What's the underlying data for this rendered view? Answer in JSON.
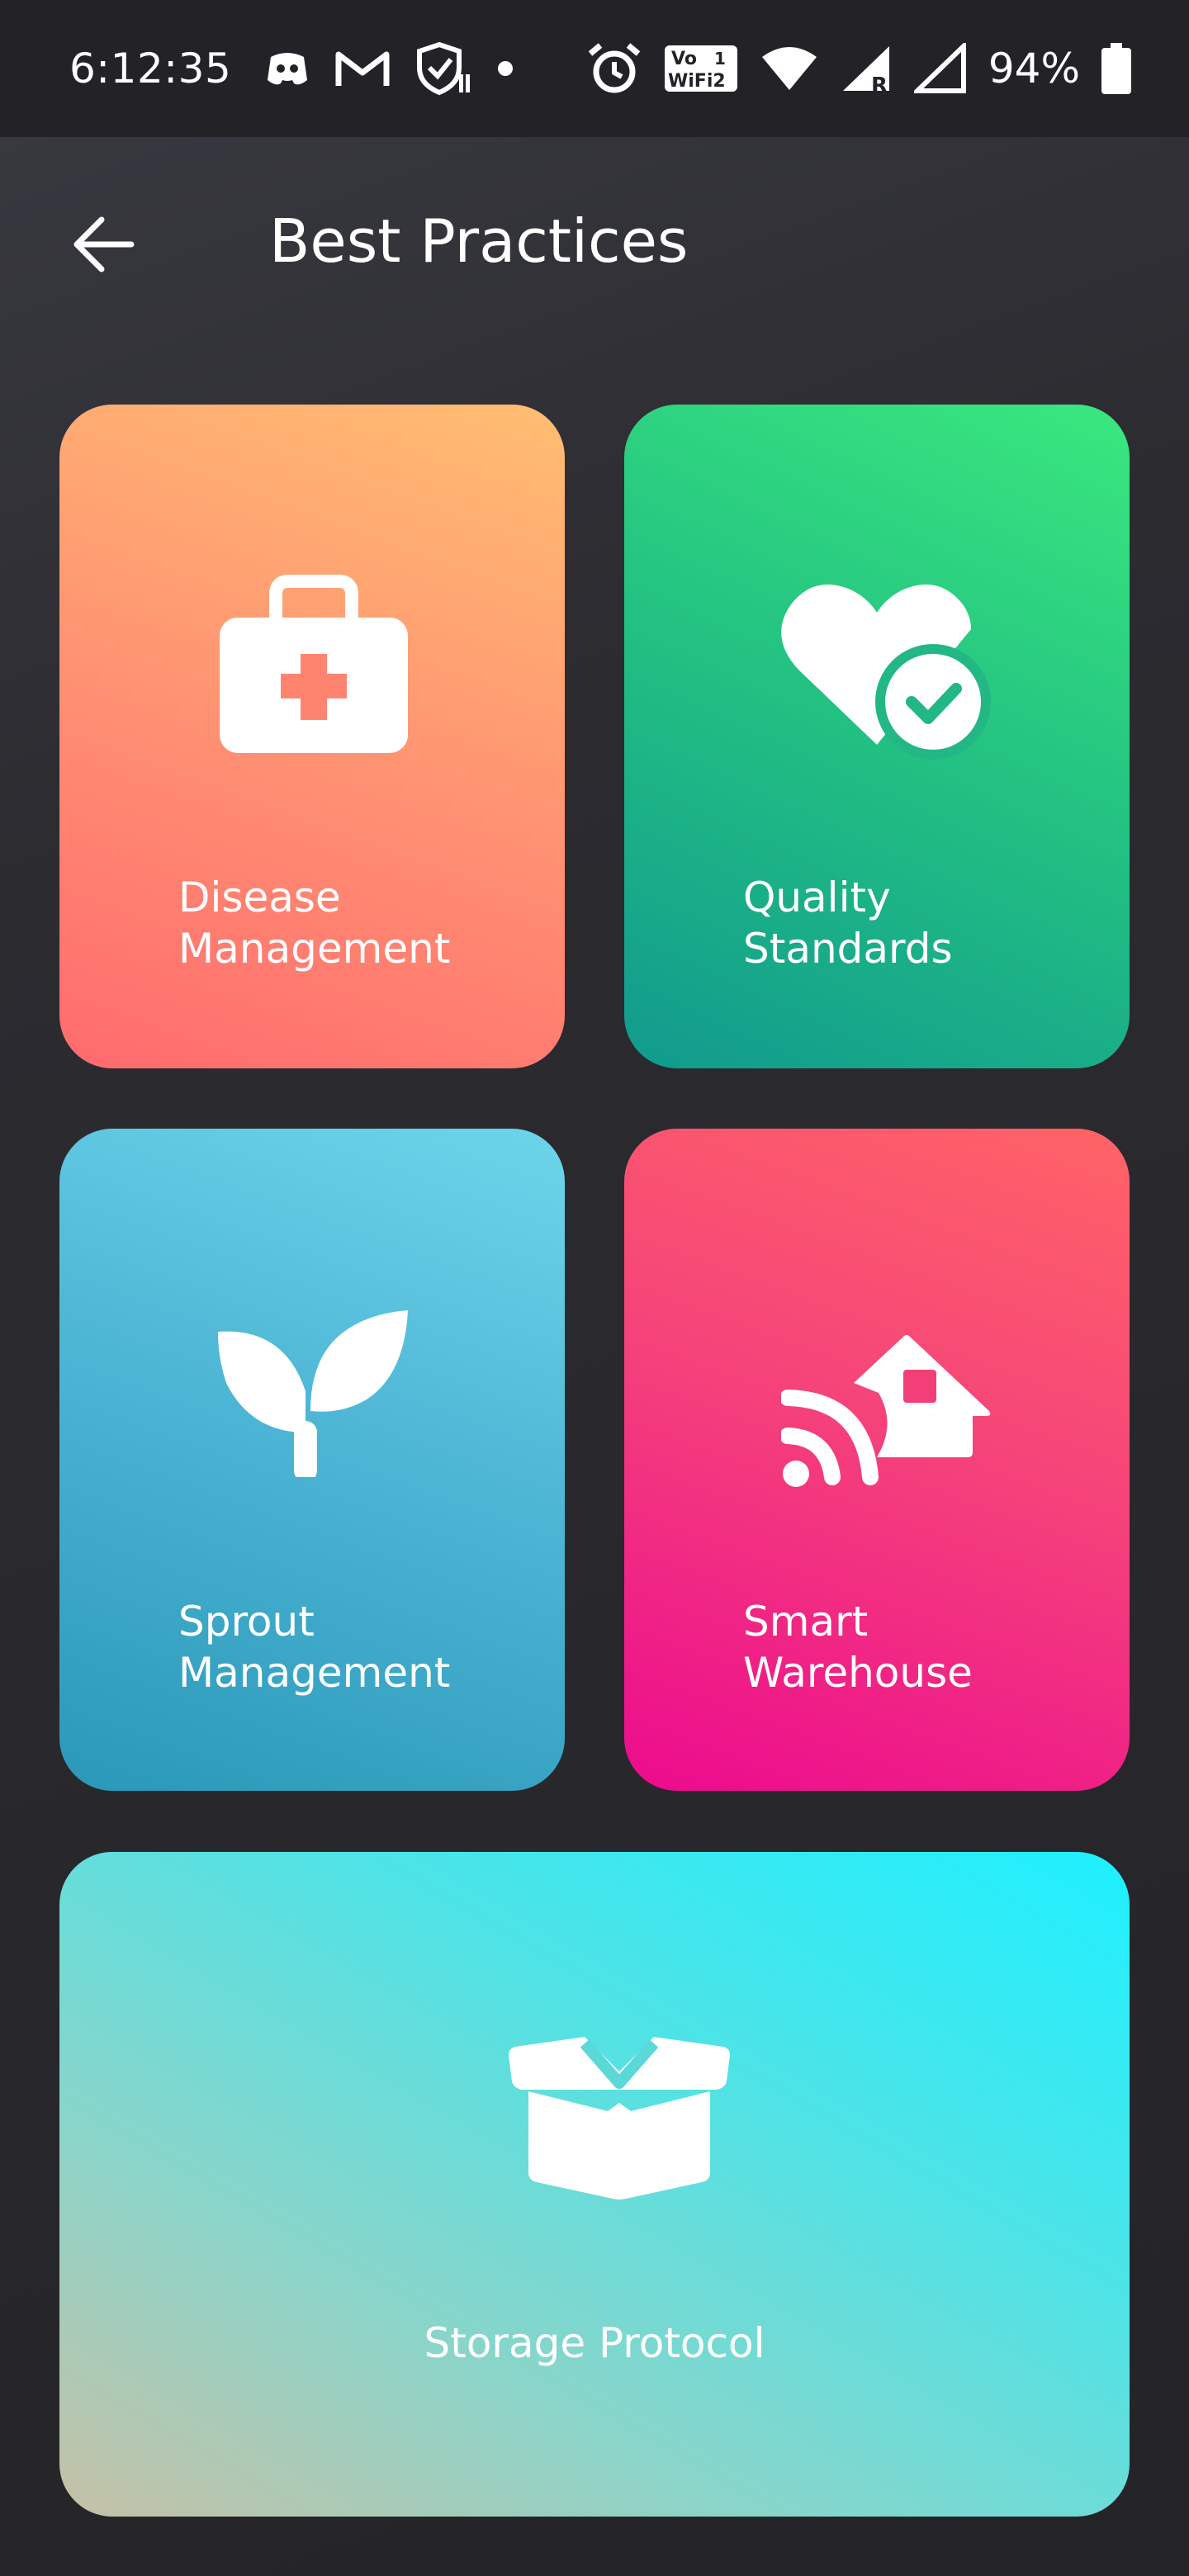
{
  "status_bar": {
    "time": "6:12:35",
    "battery_percent": "94%",
    "volte_label_top": "Vo",
    "volte_label_bottom": "WiFi2"
  },
  "header": {
    "title": "Best Practices"
  },
  "cards": [
    {
      "label": "Disease\nManagement",
      "icon": "first-aid-kit-icon"
    },
    {
      "label": "Quality\nStandards",
      "icon": "heart-check-icon"
    },
    {
      "label": "Sprout\nManagement",
      "icon": "sprout-icon"
    },
    {
      "label": "Smart\nWarehouse",
      "icon": "smart-home-icon"
    },
    {
      "label": "Storage Protocol",
      "icon": "open-box-icon"
    }
  ],
  "colors": {
    "disease": "#ff8f72",
    "quality": "#22c082",
    "sprout": "#4bb3d3",
    "warehouse": "#f5437a",
    "storage": "#4ee3e6"
  }
}
